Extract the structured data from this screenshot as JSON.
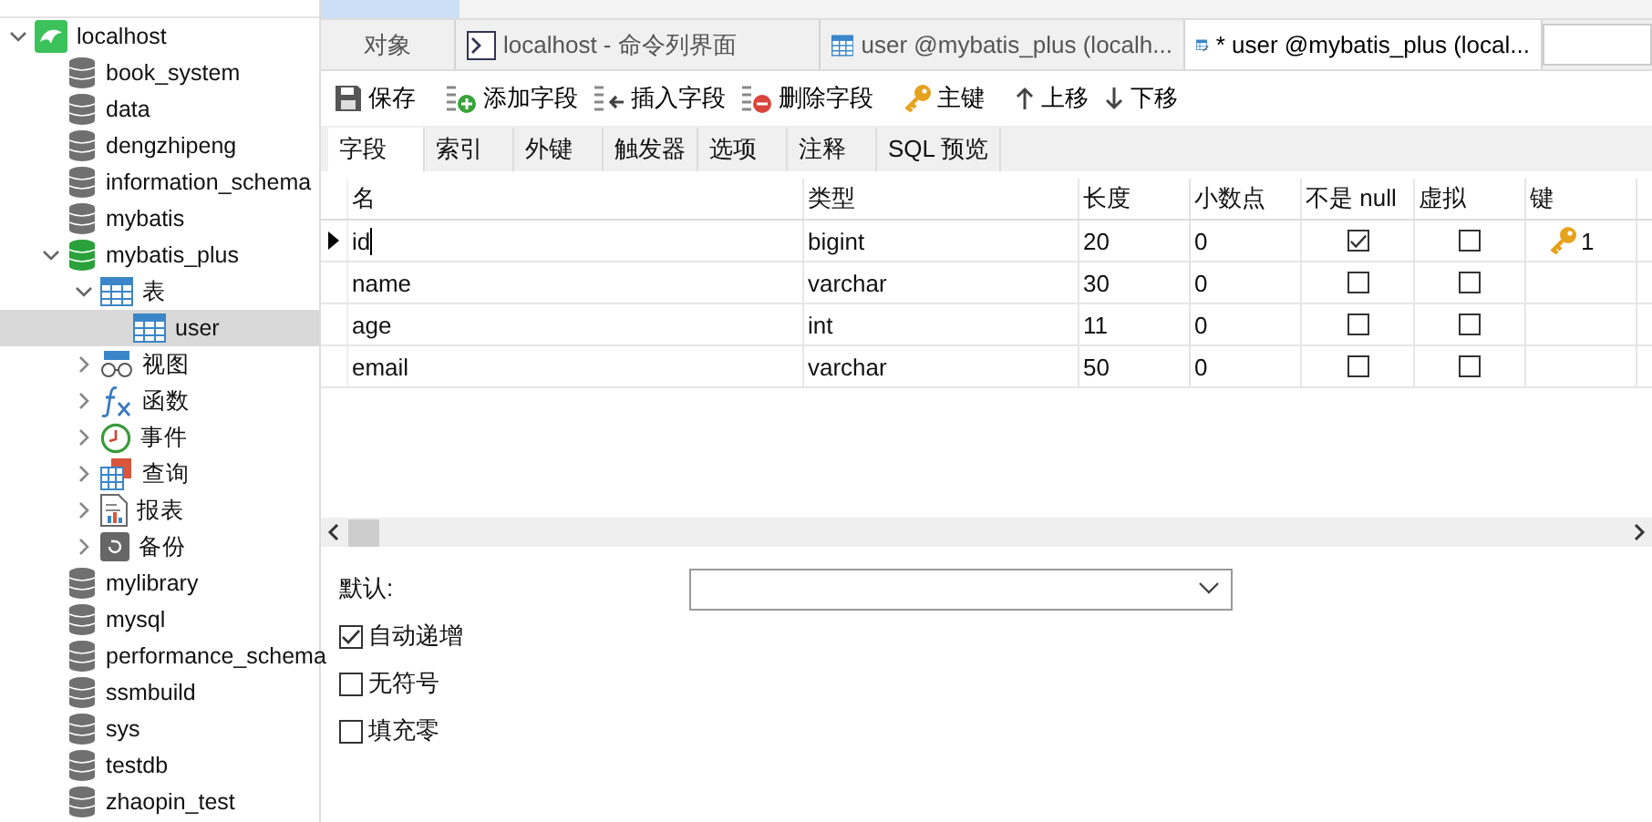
{
  "sidebar": {
    "tree": [
      {
        "label": "localhost",
        "kind": "server",
        "expanded": true,
        "children": [
          {
            "label": "book_system",
            "kind": "database",
            "open": false
          },
          {
            "label": "data",
            "kind": "database",
            "open": false
          },
          {
            "label": "dengzhipeng",
            "kind": "database",
            "open": false
          },
          {
            "label": "information_schema",
            "kind": "database",
            "open": false
          },
          {
            "label": "mybatis",
            "kind": "database",
            "open": false
          },
          {
            "label": "mybatis_plus",
            "kind": "database",
            "open": true,
            "expanded": true,
            "children": [
              {
                "label": "表",
                "kind": "tables",
                "expanded": true,
                "children": [
                  {
                    "label": "user",
                    "kind": "table",
                    "selected": true
                  }
                ]
              },
              {
                "label": "视图",
                "kind": "views",
                "expanded": false
              },
              {
                "label": "函数",
                "kind": "functions",
                "expanded": false
              },
              {
                "label": "事件",
                "kind": "events",
                "expanded": false
              },
              {
                "label": "查询",
                "kind": "queries",
                "expanded": false
              },
              {
                "label": "报表",
                "kind": "reports",
                "expanded": false
              },
              {
                "label": "备份",
                "kind": "backups",
                "expanded": false
              }
            ]
          },
          {
            "label": "mylibrary",
            "kind": "database",
            "open": false
          },
          {
            "label": "mysql",
            "kind": "database",
            "open": false
          },
          {
            "label": "performance_schema",
            "kind": "database",
            "open": false
          },
          {
            "label": "ssmbuild",
            "kind": "database",
            "open": false
          },
          {
            "label": "sys",
            "kind": "database",
            "open": false
          },
          {
            "label": "testdb",
            "kind": "database",
            "open": false
          },
          {
            "label": "zhaopin_test",
            "kind": "database",
            "open": false
          }
        ]
      }
    ]
  },
  "tabs": [
    {
      "label": "对象",
      "kind": "plain",
      "selected": false
    },
    {
      "label": "localhost - 命令列界面",
      "kind": "console",
      "selected": false
    },
    {
      "label": "user @mybatis_plus (localh...",
      "kind": "table",
      "selected": false
    },
    {
      "label": "* user @mybatis_plus (local...",
      "kind": "design",
      "selected": true
    }
  ],
  "toolbar": [
    {
      "label": "保存",
      "kind": "save"
    },
    {
      "label": "添加字段",
      "kind": "add"
    },
    {
      "label": "插入字段",
      "kind": "insert"
    },
    {
      "label": "删除字段",
      "kind": "delete"
    },
    {
      "label": "主键",
      "kind": "key"
    },
    {
      "label": "上移",
      "kind": "up"
    },
    {
      "label": "下移",
      "kind": "down"
    }
  ],
  "subtabs": [
    {
      "label": "字段",
      "selected": true
    },
    {
      "label": "索引",
      "selected": false
    },
    {
      "label": "外键",
      "selected": false
    },
    {
      "label": "触发器",
      "selected": false
    },
    {
      "label": "选项",
      "selected": false
    },
    {
      "label": "注释",
      "selected": false
    },
    {
      "label": "SQL 预览",
      "selected": false
    }
  ],
  "table": {
    "columns": [
      "名",
      "类型",
      "长度",
      "小数点",
      "不是 null",
      "虚拟",
      "键"
    ],
    "rows": [
      {
        "name": "id",
        "type": "bigint",
        "length": "20",
        "decimals": "0",
        "not_null": true,
        "virtual": false,
        "key": "1",
        "selected": true
      },
      {
        "name": "name",
        "type": "varchar",
        "length": "30",
        "decimals": "0",
        "not_null": false,
        "virtual": false,
        "selected": false
      },
      {
        "name": "age",
        "type": "int",
        "length": "11",
        "decimals": "0",
        "not_null": false,
        "virtual": false,
        "selected": false
      },
      {
        "name": "email",
        "type": "varchar",
        "length": "50",
        "decimals": "0",
        "not_null": false,
        "virtual": false,
        "selected": false
      }
    ]
  },
  "properties": {
    "default_label": "默认:",
    "options": [
      {
        "label": "自动递增",
        "checked": true
      },
      {
        "label": "无符号",
        "checked": false
      },
      {
        "label": "填充零",
        "checked": false
      }
    ]
  }
}
